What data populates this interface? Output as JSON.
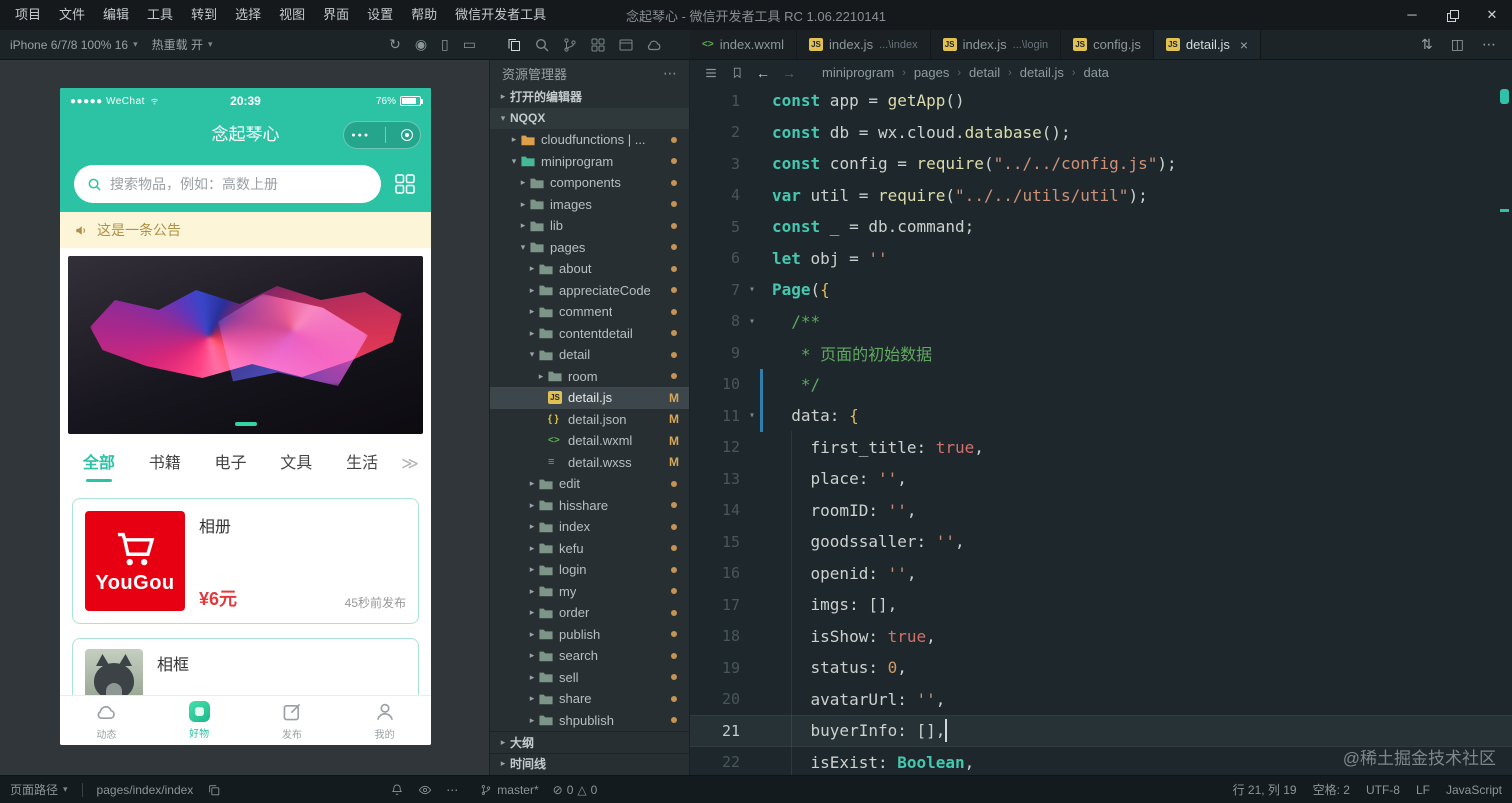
{
  "colors": {
    "accent_teal": "#2cc3a5",
    "logo_red": "#e60012",
    "price_red": "#e4393c",
    "notice_bg": "#fcf5d8",
    "notice_text": "#b09046",
    "editor_bg": "#1e282c",
    "git_modified": "#d8a657"
  },
  "titlebar": {
    "menus": [
      "项目",
      "文件",
      "编辑",
      "工具",
      "转到",
      "选择",
      "视图",
      "界面",
      "设置",
      "帮助",
      "微信开发者工具"
    ],
    "title": "念起琴心 - 微信开发者工具 RC 1.06.2210141"
  },
  "toolbar": {
    "device_label": "iPhone 6/7/8 100% 16",
    "hot_reload_label": "热重载 开"
  },
  "editor_tabs": [
    {
      "label": "index.wxml",
      "icon": "wxml"
    },
    {
      "label": "index.js",
      "desc": "...\\index",
      "icon": "js"
    },
    {
      "label": "index.js",
      "desc": "...\\login",
      "icon": "js"
    },
    {
      "label": "config.js",
      "icon": "js"
    },
    {
      "label": "detail.js",
      "icon": "js",
      "active": true
    }
  ],
  "breadcrumb": [
    "miniprogram",
    "pages",
    "detail",
    "detail.js",
    "data"
  ],
  "sidebar": {
    "title": "资源管理器",
    "open_editors": "打开的编辑器",
    "root": "NQQX",
    "outline": "大纲",
    "timeline": "时间线",
    "tree": [
      {
        "label": "cloudfunctions | ...",
        "level": 1,
        "kind": "folder",
        "state": "closed",
        "fcolor": "#dd9f4a",
        "dot": true
      },
      {
        "label": "miniprogram",
        "level": 1,
        "kind": "folder",
        "state": "open",
        "fcolor": "#46b898",
        "dot": true
      },
      {
        "label": "components",
        "level": 2,
        "kind": "folder",
        "state": "closed",
        "dot": true
      },
      {
        "label": "images",
        "level": 2,
        "kind": "folder",
        "state": "closed",
        "dot": true
      },
      {
        "label": "lib",
        "level": 2,
        "kind": "folder",
        "state": "closed",
        "dot": true
      },
      {
        "label": "pages",
        "level": 2,
        "kind": "folder",
        "state": "open",
        "dot": true
      },
      {
        "label": "about",
        "level": 3,
        "kind": "folder",
        "state": "closed",
        "dot": true
      },
      {
        "label": "appreciateCode",
        "level": 3,
        "kind": "folder",
        "state": "closed",
        "dot": true
      },
      {
        "label": "comment",
        "level": 3,
        "kind": "folder",
        "state": "closed",
        "dot": true
      },
      {
        "label": "contentdetail",
        "level": 3,
        "kind": "folder",
        "state": "closed",
        "dot": true
      },
      {
        "label": "detail",
        "level": 3,
        "kind": "folder",
        "state": "open",
        "dot": true
      },
      {
        "label": "room",
        "level": 4,
        "kind": "folder",
        "state": "closed",
        "dot": true
      },
      {
        "label": "detail.js",
        "level": 4,
        "kind": "js",
        "badge": "M",
        "selected": true
      },
      {
        "label": "detail.json",
        "level": 4,
        "kind": "json",
        "badge": "M"
      },
      {
        "label": "detail.wxml",
        "level": 4,
        "kind": "wxml",
        "badge": "M"
      },
      {
        "label": "detail.wxss",
        "level": 4,
        "kind": "wxss",
        "badge": "M"
      },
      {
        "label": "edit",
        "level": 3,
        "kind": "folder",
        "state": "closed",
        "dot": true
      },
      {
        "label": "hisshare",
        "level": 3,
        "kind": "folder",
        "state": "closed",
        "dot": true
      },
      {
        "label": "index",
        "level": 3,
        "kind": "folder",
        "state": "closed",
        "dot": true
      },
      {
        "label": "kefu",
        "level": 3,
        "kind": "folder",
        "state": "closed",
        "dot": true
      },
      {
        "label": "login",
        "level": 3,
        "kind": "folder",
        "state": "closed",
        "dot": true
      },
      {
        "label": "my",
        "level": 3,
        "kind": "folder",
        "state": "closed",
        "dot": true
      },
      {
        "label": "order",
        "level": 3,
        "kind": "folder",
        "state": "closed",
        "dot": true
      },
      {
        "label": "publish",
        "level": 3,
        "kind": "folder",
        "state": "closed",
        "dot": true
      },
      {
        "label": "search",
        "level": 3,
        "kind": "folder",
        "state": "closed",
        "dot": true
      },
      {
        "label": "sell",
        "level": 3,
        "kind": "folder",
        "state": "closed",
        "dot": true
      },
      {
        "label": "share",
        "level": 3,
        "kind": "folder",
        "state": "closed",
        "dot": true
      },
      {
        "label": "shpublish",
        "level": 3,
        "kind": "folder",
        "state": "closed",
        "dot": true
      }
    ]
  },
  "code": {
    "lines": [
      {
        "n": 1,
        "tokens": [
          [
            "k",
            "const"
          ],
          [
            "p",
            " app = "
          ],
          [
            "f",
            "getApp"
          ],
          [
            "p",
            "()"
          ]
        ]
      },
      {
        "n": 2,
        "tokens": [
          [
            "k",
            "const"
          ],
          [
            "p",
            " db = wx.cloud."
          ],
          [
            "f",
            "database"
          ],
          [
            "p",
            "();"
          ]
        ]
      },
      {
        "n": 3,
        "tokens": [
          [
            "k",
            "const"
          ],
          [
            "p",
            " config = "
          ],
          [
            "f",
            "require"
          ],
          [
            "p",
            "("
          ],
          [
            "s",
            "\"../../config.js\""
          ],
          [
            "p",
            ");"
          ]
        ]
      },
      {
        "n": 4,
        "tokens": [
          [
            "k",
            "var"
          ],
          [
            "p",
            " util = "
          ],
          [
            "f",
            "require"
          ],
          [
            "p",
            "("
          ],
          [
            "s",
            "\"../../utils/util\""
          ],
          [
            "p",
            ");"
          ]
        ]
      },
      {
        "n": 5,
        "tokens": [
          [
            "k",
            "const"
          ],
          [
            "p",
            " _ = db.command;"
          ]
        ]
      },
      {
        "n": 6,
        "tokens": [
          [
            "k",
            "let"
          ],
          [
            "p",
            " obj = "
          ],
          [
            "s",
            "''"
          ]
        ]
      },
      {
        "n": 7,
        "fold": true,
        "tokens": [
          [
            "t",
            "Page"
          ],
          [
            "p",
            "("
          ],
          [
            "br",
            "{"
          ]
        ]
      },
      {
        "n": 8,
        "fold": true,
        "tokens": [
          [
            "p",
            "  "
          ],
          [
            "c",
            "/**"
          ]
        ]
      },
      {
        "n": 9,
        "tokens": [
          [
            "p",
            "   "
          ],
          [
            "c",
            "* 页面的初始数据"
          ]
        ]
      },
      {
        "n": 10,
        "git": true,
        "tokens": [
          [
            "p",
            "   "
          ],
          [
            "c",
            "*/"
          ]
        ]
      },
      {
        "n": 11,
        "git": true,
        "fold": true,
        "tokens": [
          [
            "p",
            "  data: "
          ],
          [
            "br",
            "{"
          ]
        ]
      },
      {
        "n": 12,
        "tokens": [
          [
            "p",
            "    first_title: "
          ],
          [
            "b",
            "true"
          ],
          [
            "p",
            ","
          ]
        ]
      },
      {
        "n": 13,
        "tokens": [
          [
            "p",
            "    place: "
          ],
          [
            "s",
            "''"
          ],
          [
            "p",
            ","
          ]
        ]
      },
      {
        "n": 14,
        "tokens": [
          [
            "p",
            "    roomID: "
          ],
          [
            "s",
            "''"
          ],
          [
            "p",
            ","
          ]
        ]
      },
      {
        "n": 15,
        "tokens": [
          [
            "p",
            "    goodssaller: "
          ],
          [
            "s",
            "''"
          ],
          [
            "p",
            ","
          ]
        ]
      },
      {
        "n": 16,
        "tokens": [
          [
            "p",
            "    openid: "
          ],
          [
            "s",
            "''"
          ],
          [
            "p",
            ","
          ]
        ]
      },
      {
        "n": 17,
        "tokens": [
          [
            "p",
            "    imgs: [],"
          ]
        ]
      },
      {
        "n": 18,
        "tokens": [
          [
            "p",
            "    isShow: "
          ],
          [
            "b",
            "true"
          ],
          [
            "p",
            ","
          ]
        ]
      },
      {
        "n": 19,
        "tokens": [
          [
            "p",
            "    status: "
          ],
          [
            "num",
            "0"
          ],
          [
            "p",
            ","
          ]
        ]
      },
      {
        "n": 20,
        "tokens": [
          [
            "p",
            "    avatarUrl: "
          ],
          [
            "s",
            "''"
          ],
          [
            "p",
            ","
          ]
        ]
      },
      {
        "n": 21,
        "current": true,
        "tokens": [
          [
            "p",
            "    buyerInfo: [],"
          ]
        ]
      },
      {
        "n": 22,
        "tokens": [
          [
            "p",
            "    isExist: "
          ],
          [
            "t",
            "Boolean"
          ],
          [
            "p",
            ","
          ]
        ]
      }
    ]
  },
  "statusbar": {
    "page_path_label": "页面路径",
    "page_path_value": "pages/index/index",
    "branch": "master*",
    "errors": "0",
    "warnings": "0",
    "cursor": "行 21, 列 19",
    "spaces": "空格: 2",
    "encoding": "UTF-8",
    "eol": "LF",
    "language": "JavaScript"
  },
  "watermark": "@稀土掘金技术社区",
  "phone": {
    "carrier": "●●●●● WeChat",
    "time": "20:39",
    "battery": "76%",
    "nav_title": "念起琴心",
    "capsule_dots": "●●●",
    "search_placeholder": "搜索物品，例如：高数上册",
    "notice": "这是一条公告",
    "category_tabs": [
      "全部",
      "书籍",
      "电子",
      "文具",
      "生活"
    ],
    "more_tabs": "≫",
    "cards": [
      {
        "logo": "YouGou",
        "title": "相册",
        "price": "¥6元",
        "time": "45秒前发布"
      },
      {
        "title": "相框"
      }
    ],
    "tabbar": [
      {
        "label": "动态",
        "icon": "cloud"
      },
      {
        "label": "好物",
        "icon": "goods",
        "active": true
      },
      {
        "label": "发布",
        "icon": "publish"
      },
      {
        "label": "我的",
        "icon": "me"
      }
    ]
  }
}
